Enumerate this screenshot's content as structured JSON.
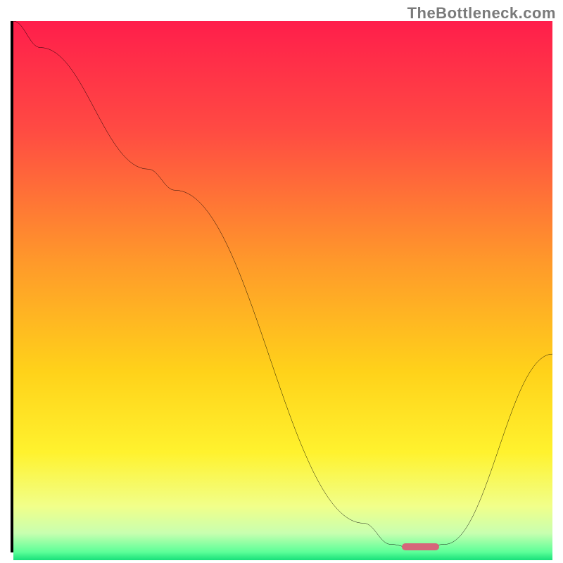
{
  "watermark": "TheBottleneck.com",
  "chart_data": {
    "type": "line",
    "title": "",
    "xlabel": "",
    "ylabel": "",
    "xlim": [
      0,
      100
    ],
    "ylim": [
      0,
      100
    ],
    "x": [
      0,
      5,
      25,
      30,
      65,
      70,
      75,
      80,
      100
    ],
    "values": [
      100,
      95,
      72,
      68,
      5,
      1,
      0,
      1,
      37
    ],
    "gradient_stops": [
      {
        "pos": 0.0,
        "color": "#ff1e4b"
      },
      {
        "pos": 0.2,
        "color": "#ff4a43"
      },
      {
        "pos": 0.45,
        "color": "#ff9a2a"
      },
      {
        "pos": 0.65,
        "color": "#ffd21a"
      },
      {
        "pos": 0.8,
        "color": "#fff22e"
      },
      {
        "pos": 0.9,
        "color": "#f1ff8a"
      },
      {
        "pos": 0.95,
        "color": "#c8ffb0"
      },
      {
        "pos": 0.985,
        "color": "#5cff98"
      },
      {
        "pos": 1.0,
        "color": "#18e07a"
      }
    ],
    "marker": {
      "x_start": 72,
      "x_end": 79,
      "color": "#d6667a"
    }
  }
}
